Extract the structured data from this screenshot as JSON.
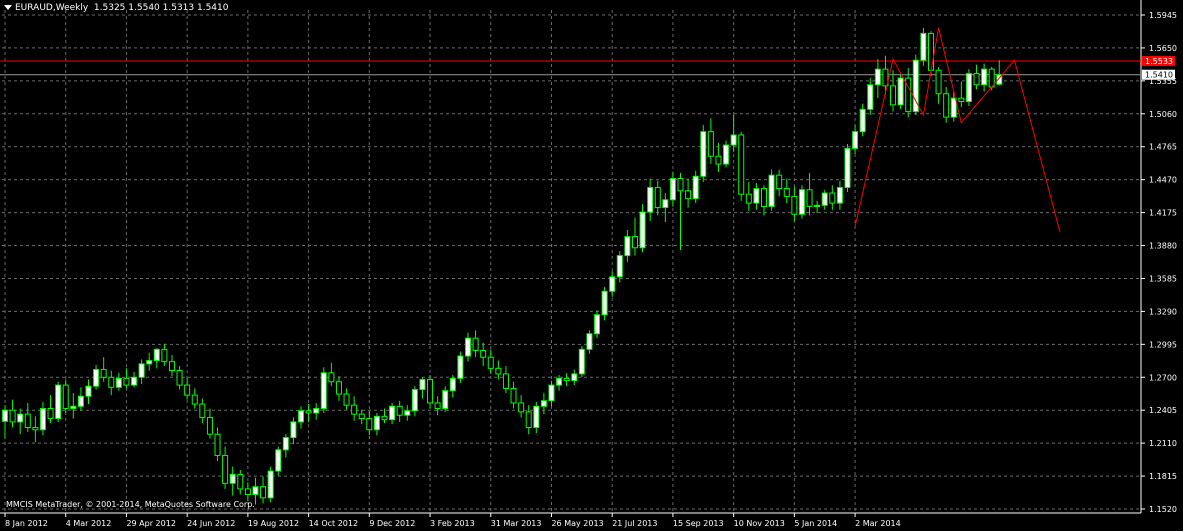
{
  "header": {
    "symbol": "EURAUD,Weekly",
    "ohlc": "1.5325 1.5540 1.5313 1.5410"
  },
  "copyright": "MMCIS MetaTrader, © 2001-2014, MetaQuotes Software Corp.",
  "colors": {
    "background": "#000000",
    "grid": "#6b6b6b",
    "axis": "#ffffff",
    "bull": "#ffffff",
    "bear": "#000000",
    "wick": "#00ff00",
    "level_line": "#ff0000",
    "bid_badge_bg": "#ffffff",
    "level_badge_bg": "#ff0000"
  },
  "chart_data": {
    "type": "candlestick",
    "symbol": "EURAUD",
    "timeframe": "Weekly",
    "grid": true,
    "y_axis_side": "right",
    "ylim": [
      1.152,
      1.5945
    ],
    "y_ticks": [
      "1.5945",
      "1.5650",
      "1.5355",
      "1.5060",
      "1.4765",
      "1.4470",
      "1.4175",
      "1.3880",
      "1.3585",
      "1.3290",
      "1.2995",
      "1.2700",
      "1.2405",
      "1.2110",
      "1.1815",
      "1.1520"
    ],
    "x_ticks": [
      "8 Jan 2012",
      "4 Mar 2012",
      "29 Apr 2012",
      "24 Jun 2012",
      "19 Aug 2012",
      "14 Oct 2012",
      "9 Dec 2012",
      "3 Feb 2013",
      "31 Mar 2013",
      "26 May 2013",
      "21 Jul 2013",
      "15 Sep 2013",
      "10 Nov 2013",
      "5 Jan 2014",
      "2 Mar 2014"
    ],
    "x_ticks_start_index": 0,
    "x_ticks_step": 8,
    "horizontal_level": {
      "value": 1.5533,
      "label": "1.5533"
    },
    "current_bid": {
      "value": 1.541,
      "label": "1.5410"
    },
    "candles": [
      {
        "o": 1.2305,
        "h": 1.245,
        "l": 1.215,
        "c": 1.2405
      },
      {
        "o": 1.2405,
        "h": 1.25,
        "l": 1.225,
        "c": 1.23
      },
      {
        "o": 1.23,
        "h": 1.242,
        "l": 1.219,
        "c": 1.237
      },
      {
        "o": 1.237,
        "h": 1.247,
        "l": 1.221,
        "c": 1.225
      },
      {
        "o": 1.225,
        "h": 1.235,
        "l": 1.212,
        "c": 1.223
      },
      {
        "o": 1.223,
        "h": 1.248,
        "l": 1.218,
        "c": 1.242
      },
      {
        "o": 1.242,
        "h": 1.254,
        "l": 1.229,
        "c": 1.233
      },
      {
        "o": 1.233,
        "h": 1.266,
        "l": 1.23,
        "c": 1.263
      },
      {
        "o": 1.263,
        "h": 1.268,
        "l": 1.238,
        "c": 1.242
      },
      {
        "o": 1.242,
        "h": 1.256,
        "l": 1.233,
        "c": 1.244
      },
      {
        "o": 1.244,
        "h": 1.261,
        "l": 1.24,
        "c": 1.253
      },
      {
        "o": 1.253,
        "h": 1.268,
        "l": 1.246,
        "c": 1.262
      },
      {
        "o": 1.262,
        "h": 1.281,
        "l": 1.259,
        "c": 1.277
      },
      {
        "o": 1.277,
        "h": 1.288,
        "l": 1.266,
        "c": 1.27
      },
      {
        "o": 1.27,
        "h": 1.276,
        "l": 1.254,
        "c": 1.261
      },
      {
        "o": 1.261,
        "h": 1.274,
        "l": 1.258,
        "c": 1.269
      },
      {
        "o": 1.269,
        "h": 1.278,
        "l": 1.26,
        "c": 1.263
      },
      {
        "o": 1.263,
        "h": 1.275,
        "l": 1.261,
        "c": 1.27
      },
      {
        "o": 1.27,
        "h": 1.286,
        "l": 1.264,
        "c": 1.282
      },
      {
        "o": 1.282,
        "h": 1.292,
        "l": 1.276,
        "c": 1.285
      },
      {
        "o": 1.285,
        "h": 1.296,
        "l": 1.278,
        "c": 1.295
      },
      {
        "o": 1.295,
        "h": 1.3,
        "l": 1.28,
        "c": 1.284
      },
      {
        "o": 1.284,
        "h": 1.29,
        "l": 1.271,
        "c": 1.276
      },
      {
        "o": 1.276,
        "h": 1.28,
        "l": 1.259,
        "c": 1.263
      },
      {
        "o": 1.263,
        "h": 1.27,
        "l": 1.25,
        "c": 1.254
      },
      {
        "o": 1.254,
        "h": 1.26,
        "l": 1.242,
        "c": 1.246
      },
      {
        "o": 1.246,
        "h": 1.251,
        "l": 1.229,
        "c": 1.234
      },
      {
        "o": 1.234,
        "h": 1.242,
        "l": 1.215,
        "c": 1.219
      },
      {
        "o": 1.219,
        "h": 1.225,
        "l": 1.195,
        "c": 1.2
      },
      {
        "o": 1.2,
        "h": 1.208,
        "l": 1.17,
        "c": 1.175
      },
      {
        "o": 1.175,
        "h": 1.19,
        "l": 1.164,
        "c": 1.183
      },
      {
        "o": 1.183,
        "h": 1.187,
        "l": 1.165,
        "c": 1.17
      },
      {
        "o": 1.17,
        "h": 1.176,
        "l": 1.159,
        "c": 1.165
      },
      {
        "o": 1.165,
        "h": 1.18,
        "l": 1.156,
        "c": 1.172
      },
      {
        "o": 1.172,
        "h": 1.181,
        "l": 1.157,
        "c": 1.162
      },
      {
        "o": 1.162,
        "h": 1.19,
        "l": 1.158,
        "c": 1.186
      },
      {
        "o": 1.186,
        "h": 1.208,
        "l": 1.182,
        "c": 1.205
      },
      {
        "o": 1.205,
        "h": 1.219,
        "l": 1.198,
        "c": 1.216
      },
      {
        "o": 1.216,
        "h": 1.234,
        "l": 1.21,
        "c": 1.23
      },
      {
        "o": 1.23,
        "h": 1.244,
        "l": 1.224,
        "c": 1.24
      },
      {
        "o": 1.24,
        "h": 1.246,
        "l": 1.23,
        "c": 1.238
      },
      {
        "o": 1.238,
        "h": 1.247,
        "l": 1.232,
        "c": 1.242
      },
      {
        "o": 1.242,
        "h": 1.279,
        "l": 1.238,
        "c": 1.274
      },
      {
        "o": 1.274,
        "h": 1.283,
        "l": 1.262,
        "c": 1.266
      },
      {
        "o": 1.266,
        "h": 1.271,
        "l": 1.249,
        "c": 1.255
      },
      {
        "o": 1.255,
        "h": 1.26,
        "l": 1.241,
        "c": 1.245
      },
      {
        "o": 1.245,
        "h": 1.253,
        "l": 1.231,
        "c": 1.237
      },
      {
        "o": 1.237,
        "h": 1.241,
        "l": 1.228,
        "c": 1.233
      },
      {
        "o": 1.233,
        "h": 1.24,
        "l": 1.218,
        "c": 1.223
      },
      {
        "o": 1.223,
        "h": 1.238,
        "l": 1.218,
        "c": 1.235
      },
      {
        "o": 1.235,
        "h": 1.242,
        "l": 1.229,
        "c": 1.232
      },
      {
        "o": 1.232,
        "h": 1.247,
        "l": 1.228,
        "c": 1.244
      },
      {
        "o": 1.244,
        "h": 1.249,
        "l": 1.23,
        "c": 1.236
      },
      {
        "o": 1.236,
        "h": 1.245,
        "l": 1.231,
        "c": 1.24
      },
      {
        "o": 1.24,
        "h": 1.262,
        "l": 1.235,
        "c": 1.259
      },
      {
        "o": 1.259,
        "h": 1.27,
        "l": 1.251,
        "c": 1.268
      },
      {
        "o": 1.268,
        "h": 1.272,
        "l": 1.242,
        "c": 1.247
      },
      {
        "o": 1.247,
        "h": 1.253,
        "l": 1.236,
        "c": 1.242
      },
      {
        "o": 1.242,
        "h": 1.262,
        "l": 1.239,
        "c": 1.258
      },
      {
        "o": 1.258,
        "h": 1.272,
        "l": 1.252,
        "c": 1.269
      },
      {
        "o": 1.269,
        "h": 1.293,
        "l": 1.265,
        "c": 1.289
      },
      {
        "o": 1.289,
        "h": 1.31,
        "l": 1.284,
        "c": 1.305
      },
      {
        "o": 1.305,
        "h": 1.312,
        "l": 1.288,
        "c": 1.294
      },
      {
        "o": 1.294,
        "h": 1.301,
        "l": 1.28,
        "c": 1.288
      },
      {
        "o": 1.288,
        "h": 1.295,
        "l": 1.273,
        "c": 1.278
      },
      {
        "o": 1.278,
        "h": 1.285,
        "l": 1.268,
        "c": 1.273
      },
      {
        "o": 1.273,
        "h": 1.28,
        "l": 1.256,
        "c": 1.26
      },
      {
        "o": 1.26,
        "h": 1.266,
        "l": 1.242,
        "c": 1.247
      },
      {
        "o": 1.247,
        "h": 1.254,
        "l": 1.234,
        "c": 1.239
      },
      {
        "o": 1.239,
        "h": 1.245,
        "l": 1.219,
        "c": 1.225
      },
      {
        "o": 1.225,
        "h": 1.248,
        "l": 1.22,
        "c": 1.244
      },
      {
        "o": 1.244,
        "h": 1.256,
        "l": 1.237,
        "c": 1.249
      },
      {
        "o": 1.249,
        "h": 1.267,
        "l": 1.244,
        "c": 1.263
      },
      {
        "o": 1.263,
        "h": 1.272,
        "l": 1.258,
        "c": 1.269
      },
      {
        "o": 1.269,
        "h": 1.274,
        "l": 1.262,
        "c": 1.267
      },
      {
        "o": 1.267,
        "h": 1.277,
        "l": 1.263,
        "c": 1.273
      },
      {
        "o": 1.273,
        "h": 1.298,
        "l": 1.27,
        "c": 1.295
      },
      {
        "o": 1.295,
        "h": 1.312,
        "l": 1.291,
        "c": 1.309
      },
      {
        "o": 1.309,
        "h": 1.33,
        "l": 1.305,
        "c": 1.326
      },
      {
        "o": 1.326,
        "h": 1.351,
        "l": 1.321,
        "c": 1.347
      },
      {
        "o": 1.347,
        "h": 1.365,
        "l": 1.342,
        "c": 1.36
      },
      {
        "o": 1.36,
        "h": 1.383,
        "l": 1.355,
        "c": 1.379
      },
      {
        "o": 1.379,
        "h": 1.402,
        "l": 1.373,
        "c": 1.396
      },
      {
        "o": 1.396,
        "h": 1.413,
        "l": 1.379,
        "c": 1.386
      },
      {
        "o": 1.386,
        "h": 1.425,
        "l": 1.382,
        "c": 1.418
      },
      {
        "o": 1.418,
        "h": 1.448,
        "l": 1.41,
        "c": 1.44
      },
      {
        "o": 1.44,
        "h": 1.446,
        "l": 1.415,
        "c": 1.422
      },
      {
        "o": 1.422,
        "h": 1.435,
        "l": 1.409,
        "c": 1.429
      },
      {
        "o": 1.429,
        "h": 1.454,
        "l": 1.423,
        "c": 1.448
      },
      {
        "o": 1.448,
        "h": 1.453,
        "l": 1.384,
        "c": 1.437
      },
      {
        "o": 1.437,
        "h": 1.448,
        "l": 1.422,
        "c": 1.43
      },
      {
        "o": 1.43,
        "h": 1.455,
        "l": 1.426,
        "c": 1.45
      },
      {
        "o": 1.45,
        "h": 1.496,
        "l": 1.445,
        "c": 1.49
      },
      {
        "o": 1.49,
        "h": 1.502,
        "l": 1.461,
        "c": 1.468
      },
      {
        "o": 1.468,
        "h": 1.48,
        "l": 1.454,
        "c": 1.461
      },
      {
        "o": 1.461,
        "h": 1.482,
        "l": 1.458,
        "c": 1.478
      },
      {
        "o": 1.478,
        "h": 1.505,
        "l": 1.472,
        "c": 1.487
      },
      {
        "o": 1.487,
        "h": 1.49,
        "l": 1.428,
        "c": 1.434
      },
      {
        "o": 1.434,
        "h": 1.445,
        "l": 1.419,
        "c": 1.426
      },
      {
        "o": 1.426,
        "h": 1.444,
        "l": 1.42,
        "c": 1.439
      },
      {
        "o": 1.439,
        "h": 1.442,
        "l": 1.415,
        "c": 1.423
      },
      {
        "o": 1.423,
        "h": 1.456,
        "l": 1.419,
        "c": 1.451
      },
      {
        "o": 1.451,
        "h": 1.456,
        "l": 1.432,
        "c": 1.439
      },
      {
        "o": 1.439,
        "h": 1.448,
        "l": 1.426,
        "c": 1.432
      },
      {
        "o": 1.432,
        "h": 1.441,
        "l": 1.41,
        "c": 1.416
      },
      {
        "o": 1.416,
        "h": 1.442,
        "l": 1.412,
        "c": 1.438
      },
      {
        "o": 1.438,
        "h": 1.453,
        "l": 1.415,
        "c": 1.423
      },
      {
        "o": 1.423,
        "h": 1.428,
        "l": 1.417,
        "c": 1.424
      },
      {
        "o": 1.424,
        "h": 1.438,
        "l": 1.42,
        "c": 1.435
      },
      {
        "o": 1.435,
        "h": 1.442,
        "l": 1.42,
        "c": 1.426
      },
      {
        "o": 1.426,
        "h": 1.446,
        "l": 1.42,
        "c": 1.44
      },
      {
        "o": 1.44,
        "h": 1.479,
        "l": 1.436,
        "c": 1.475
      },
      {
        "o": 1.475,
        "h": 1.496,
        "l": 1.47,
        "c": 1.49
      },
      {
        "o": 1.49,
        "h": 1.515,
        "l": 1.486,
        "c": 1.51
      },
      {
        "o": 1.51,
        "h": 1.538,
        "l": 1.505,
        "c": 1.532
      },
      {
        "o": 1.532,
        "h": 1.555,
        "l": 1.52,
        "c": 1.546
      },
      {
        "o": 1.546,
        "h": 1.558,
        "l": 1.523,
        "c": 1.531
      },
      {
        "o": 1.531,
        "h": 1.545,
        "l": 1.508,
        "c": 1.514
      },
      {
        "o": 1.514,
        "h": 1.542,
        "l": 1.51,
        "c": 1.538
      },
      {
        "o": 1.538,
        "h": 1.547,
        "l": 1.503,
        "c": 1.508
      },
      {
        "o": 1.508,
        "h": 1.559,
        "l": 1.505,
        "c": 1.554
      },
      {
        "o": 1.554,
        "h": 1.583,
        "l": 1.549,
        "c": 1.578
      },
      {
        "o": 1.578,
        "h": 1.58,
        "l": 1.54,
        "c": 1.545
      },
      {
        "o": 1.545,
        "h": 1.548,
        "l": 1.515,
        "c": 1.524
      },
      {
        "o": 1.524,
        "h": 1.53,
        "l": 1.498,
        "c": 1.503
      },
      {
        "o": 1.503,
        "h": 1.526,
        "l": 1.499,
        "c": 1.52
      },
      {
        "o": 1.52,
        "h": 1.535,
        "l": 1.512,
        "c": 1.517
      },
      {
        "o": 1.517,
        "h": 1.546,
        "l": 1.513,
        "c": 1.542
      },
      {
        "o": 1.542,
        "h": 1.55,
        "l": 1.528,
        "c": 1.532
      },
      {
        "o": 1.532,
        "h": 1.551,
        "l": 1.526,
        "c": 1.546
      },
      {
        "o": 1.546,
        "h": 1.548,
        "l": 1.527,
        "c": 1.53
      },
      {
        "o": 1.5325,
        "h": 1.554,
        "l": 1.5313,
        "c": 1.541
      }
    ],
    "zigzag": [
      {
        "i": 112,
        "v": 1.405
      },
      {
        "i": 117,
        "v": 1.555
      },
      {
        "i": 121,
        "v": 1.505
      },
      {
        "i": 123,
        "v": 1.583
      },
      {
        "i": 126,
        "v": 1.498
      },
      {
        "i": 133,
        "v": 1.554
      },
      {
        "i": 139,
        "v": 1.4
      }
    ]
  }
}
